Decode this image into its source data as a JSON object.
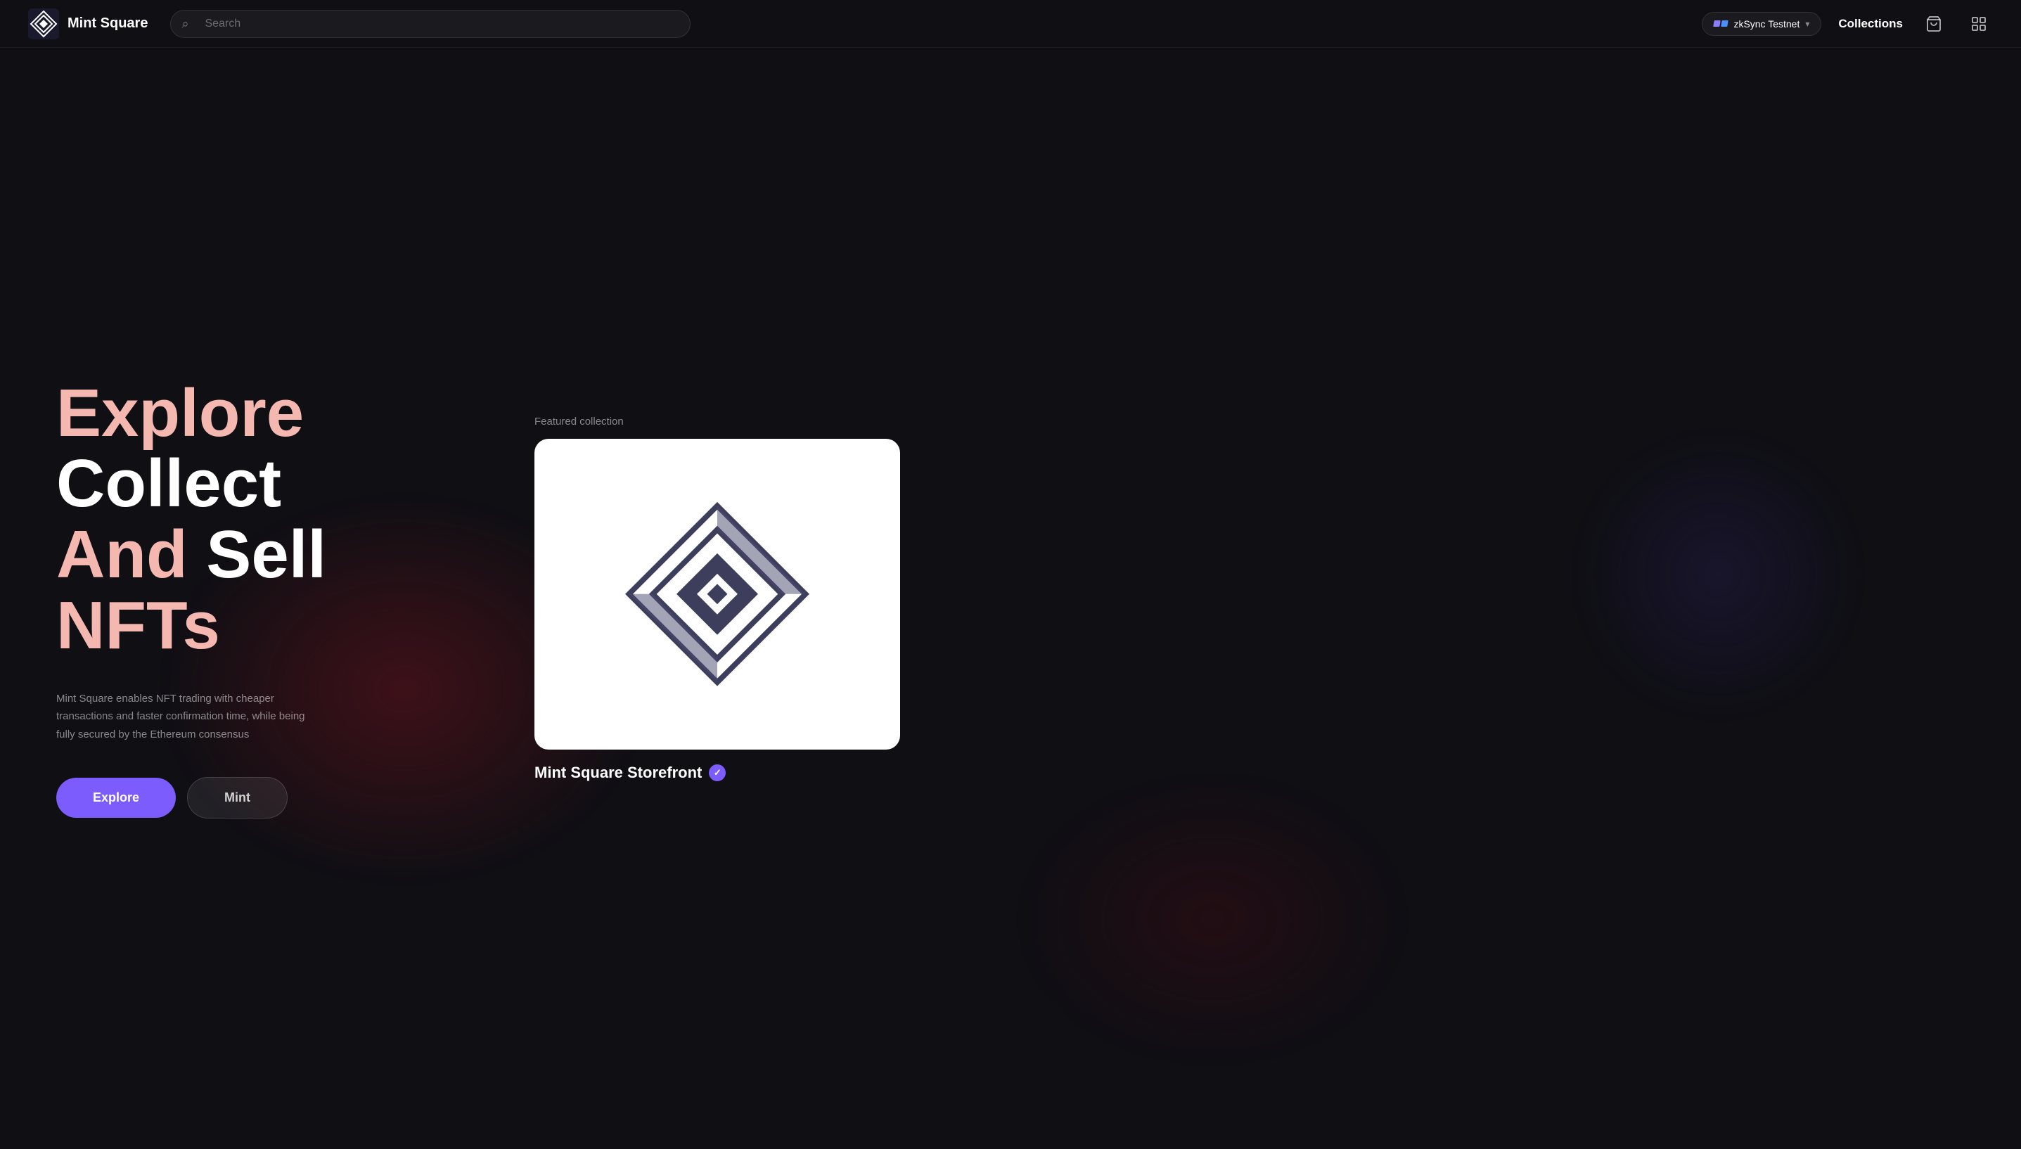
{
  "nav": {
    "logo_text": "Mint Square",
    "search_placeholder": "Search",
    "network_label": "zkSync Testnet",
    "collections_label": "Collections"
  },
  "hero": {
    "line1_word1": "Explore",
    "line1_word2": "Collect",
    "line2_word1": "And",
    "line2_word2": "Sell",
    "line3_word1": "NFTs",
    "description": "Mint Square enables NFT trading with cheaper transactions and faster confirmation time, while being fully secured by the Ethereum consensus",
    "btn_explore": "Explore",
    "btn_mint": "Mint",
    "featured_label": "Featured collection",
    "collection_name": "Mint Square Storefront"
  }
}
